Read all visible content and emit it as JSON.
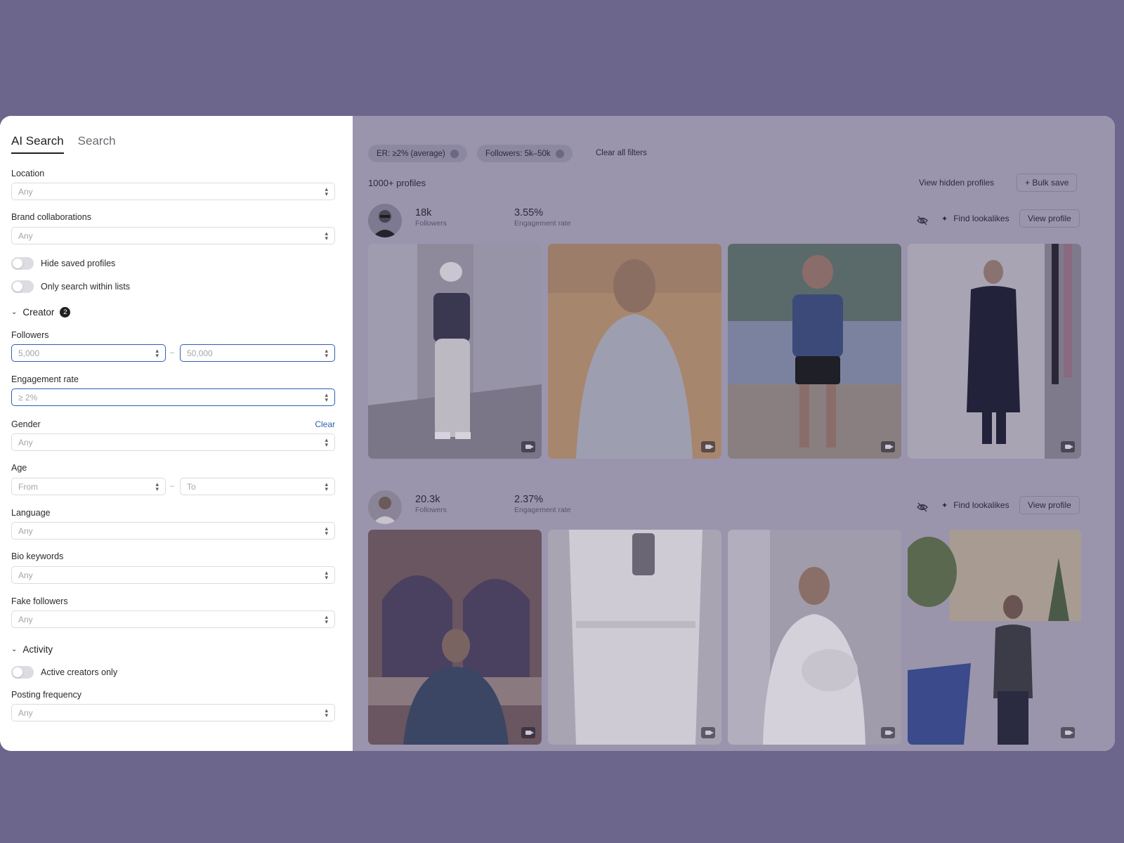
{
  "tabs": [
    {
      "label": "AI Search"
    },
    {
      "label": "Search"
    }
  ],
  "filters": {
    "location": {
      "label": "Location",
      "value": "Any"
    },
    "brand_collaborations": {
      "label": "Brand collaborations",
      "value": "Any"
    },
    "hide_saved": {
      "label": "Hide saved profiles"
    },
    "only_lists": {
      "label": "Only search within lists"
    },
    "creator_section": {
      "label": "Creator",
      "badge": "2"
    },
    "followers": {
      "label": "Followers",
      "min": "5,000",
      "max": "50,000",
      "separator": "–"
    },
    "engagement_rate": {
      "label": "Engagement rate",
      "value": "≥ 2%"
    },
    "gender": {
      "label": "Gender",
      "value": "Any",
      "clear": "Clear"
    },
    "age": {
      "label": "Age",
      "from": "From",
      "to": "To",
      "separator": "–"
    },
    "language": {
      "label": "Language",
      "value": "Any"
    },
    "bio_keywords": {
      "label": "Bio keywords",
      "value": "Any"
    },
    "fake_followers": {
      "label": "Fake followers",
      "value": "Any"
    },
    "activity_section": {
      "label": "Activity"
    },
    "active_only": {
      "label": "Active creators only"
    },
    "posting_frequency": {
      "label": "Posting frequency",
      "value": "Any"
    }
  },
  "active_chips": [
    {
      "label": "ER: ≥2% (average)"
    },
    {
      "label": "Followers: 5k–50k"
    }
  ],
  "clear_all": "Clear all filters",
  "results": {
    "count": "1000+ profiles",
    "view_hidden": "View hidden profiles",
    "bulk_save": "+ Bulk save"
  },
  "profiles": [
    {
      "followers": "18k",
      "followers_label": "Followers",
      "er": "3.55%",
      "er_label": "Engagement rate",
      "find": "Find lookalikes",
      "view": "View profile"
    },
    {
      "followers": "20.3k",
      "followers_label": "Followers",
      "er": "2.37%",
      "er_label": "Engagement rate",
      "find": "Find lookalikes",
      "view": "View profile"
    }
  ],
  "colors": {
    "accent": "#2c5fb3",
    "overlay_bg": "#9a95ad",
    "page_bg": "#6d668c"
  }
}
